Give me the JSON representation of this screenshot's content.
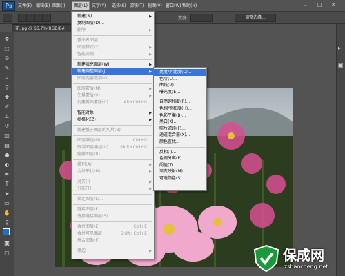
{
  "app": {
    "logo": "Ps"
  },
  "menubar": {
    "items": [
      "文件(F)",
      "编辑(E)",
      "图像(I)",
      "图层(L)",
      "文字(Y)",
      "选择(S)",
      "滤镜(T)",
      "视图(V)",
      "窗口(W)",
      "帮助(H)"
    ],
    "window_controls": [
      "–",
      "□",
      "✕"
    ]
  },
  "options_bar": {
    "label": "宽度:",
    "right_button": "调整边缘..."
  },
  "document": {
    "tab": "花.jpg @ 66.7%(RGB/8#)"
  },
  "layer_menu": {
    "items": [
      {
        "label": "新建(N)",
        "disabled": false,
        "arrow": true,
        "shortcut": ""
      },
      {
        "label": "复制图层(D)...",
        "disabled": false,
        "arrow": false,
        "shortcut": ""
      },
      {
        "label": "删除",
        "disabled": true,
        "arrow": true,
        "shortcut": ""
      },
      {
        "sep": true
      },
      {
        "label": "重命名图层...",
        "disabled": true,
        "arrow": false,
        "shortcut": ""
      },
      {
        "label": "图层样式(Y)",
        "disabled": true,
        "arrow": true,
        "shortcut": ""
      },
      {
        "label": "智能滤镜",
        "disabled": true,
        "arrow": true,
        "shortcut": ""
      },
      {
        "sep": true
      },
      {
        "label": "新建填充图层(W)",
        "disabled": false,
        "arrow": true,
        "shortcut": ""
      },
      {
        "label": "新建调整图层(J)",
        "disabled": false,
        "arrow": true,
        "shortcut": "",
        "highlight": true
      },
      {
        "label": "图层内容选项(O)...",
        "disabled": true,
        "arrow": false,
        "shortcut": ""
      },
      {
        "sep": true
      },
      {
        "label": "图层蒙版(M)",
        "disabled": true,
        "arrow": true,
        "shortcut": ""
      },
      {
        "label": "矢量蒙版(V)",
        "disabled": true,
        "arrow": true,
        "shortcut": ""
      },
      {
        "label": "创建剪贴蒙版(C)",
        "disabled": true,
        "arrow": false,
        "shortcut": "Alt+Ctrl+G"
      },
      {
        "sep": true
      },
      {
        "label": "智能对象",
        "disabled": false,
        "arrow": true,
        "shortcut": ""
      },
      {
        "label": "栅格化(Z)",
        "disabled": false,
        "arrow": true,
        "shortcut": ""
      },
      {
        "sep": true
      },
      {
        "label": "新建基于图层的切片(B)",
        "disabled": true,
        "arrow": false,
        "shortcut": ""
      },
      {
        "sep": true
      },
      {
        "label": "图层编组(G)",
        "disabled": true,
        "arrow": false,
        "shortcut": "Ctrl+G"
      },
      {
        "label": "取消图层编组(U)",
        "disabled": true,
        "arrow": false,
        "shortcut": "Shift+Ctrl+G"
      },
      {
        "label": "隐藏图层(R)",
        "disabled": true,
        "arrow": false,
        "shortcut": ""
      },
      {
        "sep": true
      },
      {
        "label": "排列(A)",
        "disabled": true,
        "arrow": true,
        "shortcut": ""
      },
      {
        "label": "合并形状(H)",
        "disabled": true,
        "arrow": true,
        "shortcut": ""
      },
      {
        "sep": true
      },
      {
        "label": "对齐(I)",
        "disabled": true,
        "arrow": true,
        "shortcut": ""
      },
      {
        "label": "分布(T)",
        "disabled": true,
        "arrow": true,
        "shortcut": ""
      },
      {
        "sep": true
      },
      {
        "label": "锁定图层(L)...",
        "disabled": true,
        "arrow": false,
        "shortcut": ""
      },
      {
        "sep": true
      },
      {
        "label": "链接图层(K)",
        "disabled": true,
        "arrow": false,
        "shortcut": ""
      },
      {
        "label": "选择链接图层(S)",
        "disabled": true,
        "arrow": false,
        "shortcut": ""
      },
      {
        "sep": true
      },
      {
        "label": "合并图层(E)",
        "disabled": true,
        "arrow": false,
        "shortcut": "Ctrl+E"
      },
      {
        "label": "合并可见图层",
        "disabled": true,
        "arrow": false,
        "shortcut": "Shift+Ctrl+E"
      },
      {
        "label": "拼合图像(F)",
        "disabled": true,
        "arrow": false,
        "shortcut": ""
      },
      {
        "sep": true
      },
      {
        "label": "修边",
        "disabled": true,
        "arrow": true,
        "shortcut": ""
      }
    ]
  },
  "adjust_submenu": {
    "items": [
      {
        "label": "亮度/对比度(C)...",
        "highlight": true
      },
      {
        "label": "色阶(L)..."
      },
      {
        "label": "曲线(V)..."
      },
      {
        "label": "曝光度(E)..."
      },
      {
        "sep": true
      },
      {
        "label": "自然饱和度(R)..."
      },
      {
        "label": "色相/饱和度(H)..."
      },
      {
        "label": "色彩平衡(B)..."
      },
      {
        "label": "黑白(K)..."
      },
      {
        "label": "照片滤镜(F)..."
      },
      {
        "label": "通道混合器(X)..."
      },
      {
        "label": "颜色查找..."
      },
      {
        "sep": true
      },
      {
        "label": "反相(I)..."
      },
      {
        "label": "色调分离(P)..."
      },
      {
        "label": "阈值(T)..."
      },
      {
        "label": "渐变映射(M)..."
      },
      {
        "label": "可选颜色(S)..."
      }
    ]
  },
  "watermark": {
    "title": "保成网",
    "url": "zsbaocheng.net"
  },
  "colors": {
    "highlight": "#3875d7",
    "fg_swatch": "#1f6fd0",
    "watermark": "#1b9a3c"
  }
}
